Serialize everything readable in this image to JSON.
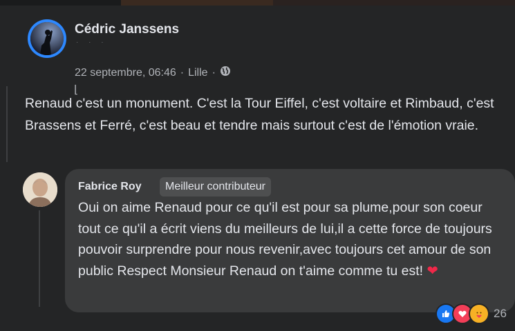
{
  "post": {
    "author": "Cédric Janssens",
    "date": "22 septembre, 06:46",
    "separator": "·",
    "location": "Lille",
    "privacy_icon": "globe-icon",
    "text": "Renaud c'est un monument. C'est la Tour Eiffel, c'est voltaire et Rimbaud, c'est Brassens et Ferré, c'est beau et tendre mais surtout c'est de l'émotion vraie."
  },
  "reply": {
    "author": "Fabrice Roy",
    "badge": "Meilleur contributeur",
    "text": "Oui on aime Renaud pour ce qu'il est pour sa plume,pour son coeur tout ce qu'il a écrit viens du meilleurs de lui,il a cette force de toujours pouvoir surprendre pour nous revenir,avec toujours cet amour de son public Respect Monsieur Renaud on t'aime comme tu est!",
    "heart_emoji": "❤",
    "reactions": {
      "icons": [
        "like-icon",
        "love-icon",
        "care-icon"
      ],
      "count": "26"
    }
  },
  "colors": {
    "background": "#242526",
    "bubble": "#3a3b3c",
    "text": "#e4e6eb",
    "secondary_text": "#b0b3b8",
    "accent": "#1877f2",
    "love": "#f33e58"
  }
}
